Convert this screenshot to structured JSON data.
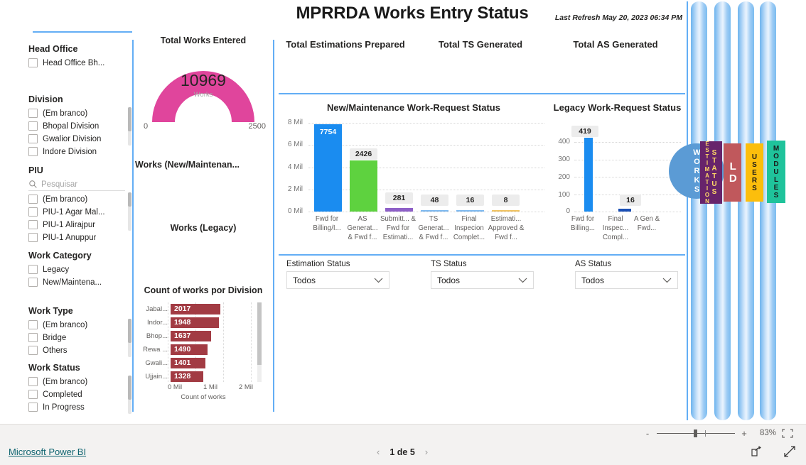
{
  "header": {
    "title": "MPRRDA Works Entry Status",
    "last_refresh": "Last Refresh May 20, 2023 06:34 PM"
  },
  "filters": {
    "head_office": {
      "title": "Head Office",
      "items": [
        {
          "label": "Head Office Bh...",
          "checked": false
        }
      ]
    },
    "division": {
      "title": "Division",
      "items": [
        {
          "label": "(Em branco)",
          "checked": false
        },
        {
          "label": "Bhopal Division",
          "checked": false
        },
        {
          "label": "Gwalior Division",
          "checked": false
        },
        {
          "label": "Indore Division",
          "checked": false
        }
      ]
    },
    "piu": {
      "title": "PIU",
      "search_placeholder": "Pesquisar",
      "items": [
        {
          "label": "(Em branco)",
          "checked": false
        },
        {
          "label": "PIU-1 Agar Mal...",
          "checked": false
        },
        {
          "label": "PIU-1 Alirajpur",
          "checked": false
        },
        {
          "label": "PIU-1 Anuppur",
          "checked": false
        }
      ]
    },
    "work_category": {
      "title": "Work Category",
      "items": [
        {
          "label": "Legacy",
          "checked": false
        },
        {
          "label": "New/Maintena...",
          "checked": false
        }
      ]
    },
    "work_type": {
      "title": "Work Type",
      "items": [
        {
          "label": "(Em branco)",
          "checked": false
        },
        {
          "label": "Bridge",
          "checked": false
        },
        {
          "label": "Others",
          "checked": false
        }
      ]
    },
    "work_status": {
      "title": "Work Status",
      "items": [
        {
          "label": "(Em branco)",
          "checked": false
        },
        {
          "label": "Completed",
          "checked": false
        },
        {
          "label": "In Progress",
          "checked": false
        }
      ]
    }
  },
  "gauge": {
    "title": "Total Works Entered",
    "value": "10969",
    "unit": "Works",
    "min": "0",
    "max": "2500",
    "color": "#e0459c"
  },
  "mini_titles": {
    "new_maintenance": "Works (New/Maintenan...",
    "legacy": "Works (Legacy)"
  },
  "kpis": [
    {
      "label": "Total Estimations Prepared"
    },
    {
      "label": "Total TS Generated"
    },
    {
      "label": "Total AS Generated"
    }
  ],
  "slicers": [
    {
      "label": "Estimation Status",
      "value": "Todos"
    },
    {
      "label": "TS Status",
      "value": "Todos"
    },
    {
      "label": "AS Status",
      "value": "Todos"
    }
  ],
  "nav": {
    "works": "WORKS",
    "estimation": "ESTIMATION",
    "status": "STATUS",
    "ld": "LD",
    "users": "USERS",
    "modules": "MODULES",
    "colors": {
      "works": "#5b9bd5",
      "estimation": "#67246b",
      "ld": "#c0585c",
      "users": "#fcbe0c",
      "modules": "#1fc39b"
    }
  },
  "statusbar": {
    "zoom": "83%",
    "minus": "-",
    "plus": "+"
  },
  "footer": {
    "brand": "Microsoft Power BI",
    "page": "1 de 5",
    "prev": "‹",
    "next": "›"
  },
  "chart_data": [
    {
      "type": "bar",
      "title": "New/Maintenance Work-Request Status",
      "categories": [
        "Fwd for Billing/I...",
        "AS Generat... & Fwd f...",
        "Submitt... & Fwd for Estimati...",
        "TS Generat... & Fwd f...",
        "Final Inspecion Complet...",
        "Estimati... Approved & Fwd f..."
      ],
      "values": [
        7754,
        2426,
        281,
        48,
        16,
        8
      ],
      "colors": [
        "#1a8cf0",
        "#5ed23f",
        "#8d5fc7",
        "#7db8ef",
        "#7db8ef",
        "#f0c260"
      ],
      "ylabel": "",
      "xlabel": "",
      "ylim": [
        0,
        8000000
      ],
      "yticks": [
        "0 Mil",
        "2 Mil",
        "4 Mil",
        "6 Mil",
        "8 Mil"
      ],
      "grid": true,
      "legend": "none"
    },
    {
      "type": "bar",
      "title": "Legacy Work-Request Status",
      "categories": [
        "Fwd for Billing...",
        "Final Inspec... Compl...",
        "A Gen & Fwd..."
      ],
      "values": [
        419,
        16,
        0
      ],
      "colors": [
        "#1a8cf0",
        "#1a4fb5",
        "#1a8cf0"
      ],
      "ylabel": "",
      "xlabel": "",
      "ylim": [
        0,
        400
      ],
      "yticks": [
        "0",
        "100",
        "200",
        "300",
        "400"
      ],
      "grid": true,
      "legend": "none"
    },
    {
      "type": "bar",
      "orientation": "horizontal",
      "title": "Count of works por Division",
      "categories": [
        "Jabal...",
        "Indor...",
        "Bhop...",
        "Rewa ...",
        "Gwali...",
        "Ujjain..."
      ],
      "values": [
        2017,
        1948,
        1637,
        1490,
        1401,
        1328
      ],
      "bar_color": "#a23b43",
      "xlabel": "Count of works",
      "ylabel": "",
      "xticks": [
        "0 Mil",
        "1 Mil",
        "2 Mil"
      ],
      "xlim": [
        0,
        2000000
      ],
      "grid": true,
      "legend": "none"
    },
    {
      "type": "gauge",
      "title": "Total Works Entered",
      "value": 10969,
      "min": 0,
      "max": 2500,
      "unit": "Works",
      "color": "#e0459c"
    }
  ]
}
